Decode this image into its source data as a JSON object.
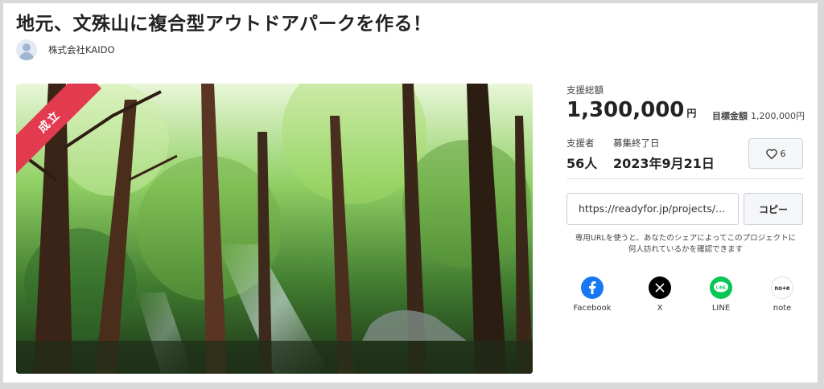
{
  "project": {
    "title": "地元、文殊山に複合型アウトドアパークを作る！",
    "owner": "株式会社KAIDO",
    "badge": "成立"
  },
  "funding": {
    "total_label": "支援総額",
    "total_value": "1,300,000",
    "currency": "円",
    "goal_label": "目標金額",
    "goal_value": "1,200,000円",
    "supporters_label": "支援者",
    "supporters_value": "56人",
    "end_label": "募集終了日",
    "end_value": "2023年9月21日",
    "like_count": "6"
  },
  "share": {
    "url": "https://readyfor.jp/projects/...",
    "copy_label": "コピー",
    "note": "専用URLを使うと、あなたのシェアによってこのプロジェクトに何人訪れているかを確認できます",
    "items": [
      {
        "label": "Facebook",
        "icon": "facebook-icon",
        "color": "#1877f2"
      },
      {
        "label": "X",
        "icon": "x-icon",
        "color": "#000000"
      },
      {
        "label": "LINE",
        "icon": "line-icon",
        "color": "#06c755"
      },
      {
        "label": "note",
        "icon": "note-icon",
        "color": "#ffffff"
      }
    ]
  },
  "colors": {
    "ribbon": "#e23a4e",
    "button_bg": "#f4f6f8",
    "border": "#c9ced5"
  }
}
